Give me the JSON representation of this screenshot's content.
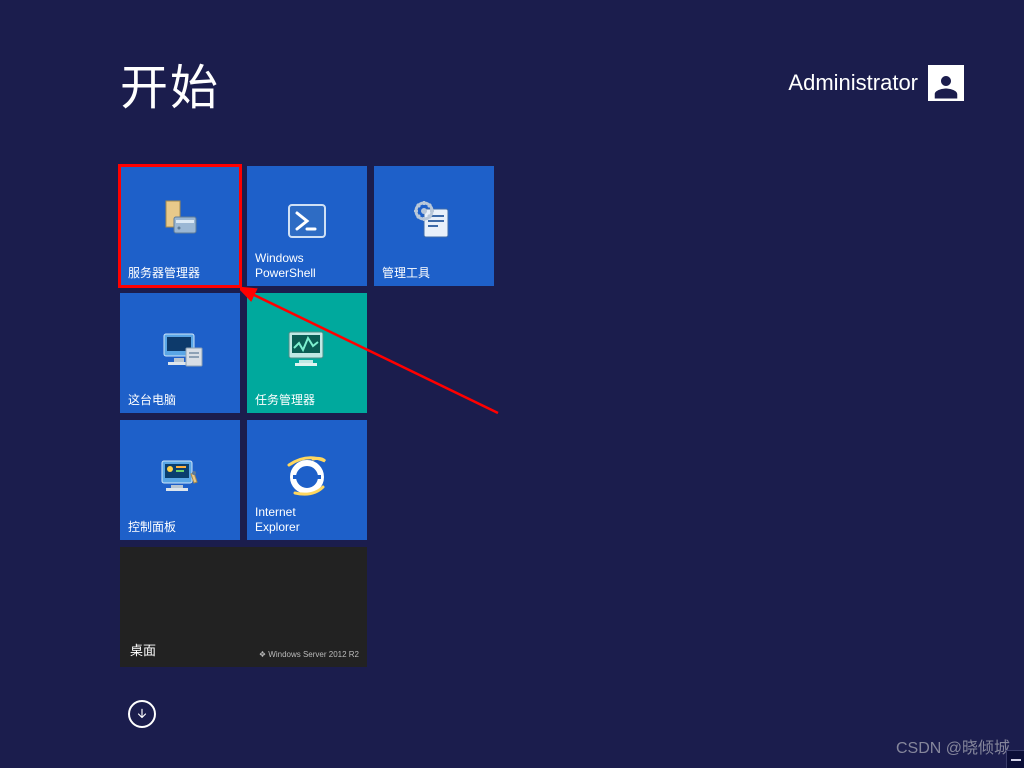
{
  "header": {
    "title": "开始",
    "username": "Administrator"
  },
  "tiles": {
    "server_manager": "服务器管理器",
    "powershell": "Windows\nPowerShell",
    "admin_tools": "管理工具",
    "this_pc": "这台电脑",
    "task_manager": "任务管理器",
    "control_panel": "控制面板",
    "ie": "Internet\nExplorer",
    "desktop": "桌面",
    "ws_mark": "❖ Windows Server 2012 R2"
  },
  "watermark": "CSDN @晓倾城"
}
